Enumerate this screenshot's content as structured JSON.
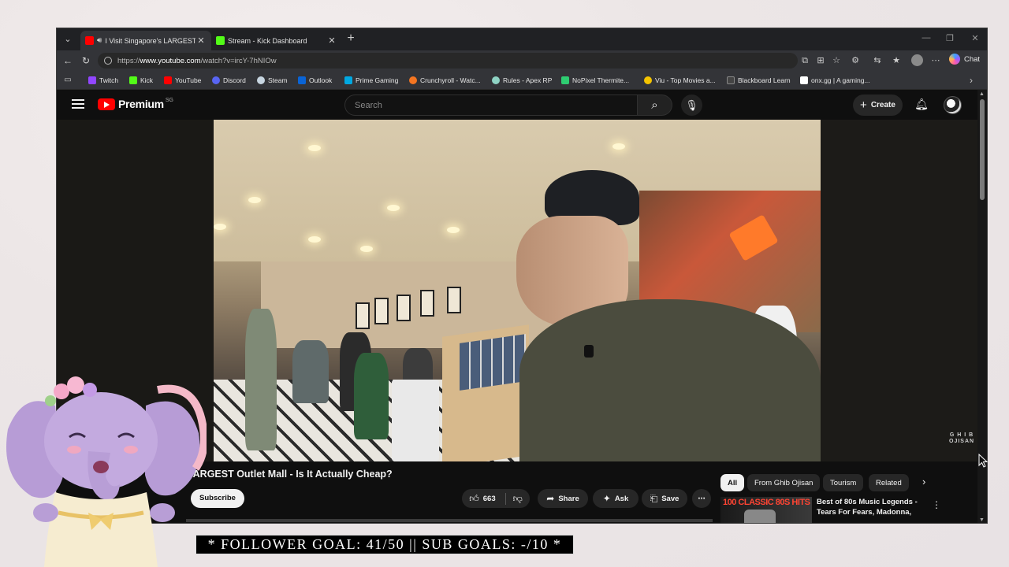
{
  "browser": {
    "tabs": [
      {
        "title": "I Visit Singapore's LARGEST O",
        "active": true,
        "audio": true,
        "favicon_color": "#ff0000"
      },
      {
        "title": "Stream - Kick Dashboard",
        "active": false,
        "audio": false,
        "favicon_color": "#53fc18"
      }
    ],
    "url_prefix": "https://",
    "url_host": "www.youtube.com",
    "url_path": "/watch?v=ircY-7hNIOw",
    "copilot_label": "Chat",
    "bookmarks": [
      {
        "label": "Twitch",
        "color": "#9146ff"
      },
      {
        "label": "Kick",
        "color": "#53fc18"
      },
      {
        "label": "YouTube",
        "color": "#ff0000"
      },
      {
        "label": "Discord",
        "color": "#5865f2"
      },
      {
        "label": "Steam",
        "color": "#c7d5e0"
      },
      {
        "label": "Outlook",
        "color": "#0a64d6"
      },
      {
        "label": "Prime Gaming",
        "color": "#00a8e1"
      },
      {
        "label": "Crunchyroll - Watc...",
        "color": "#f47521"
      },
      {
        "label": "Rules - Apex RP",
        "color": "#8fd3c4"
      },
      {
        "label": "NoPixel Thermite...",
        "color": "#2ecc71"
      },
      {
        "label": "Viu - Top Movies a...",
        "color": "#f5c400"
      },
      {
        "label": "Blackboard Learn",
        "color": "#262626"
      },
      {
        "label": "onx.gg | A gaming...",
        "color": "#ffffff"
      }
    ]
  },
  "youtube": {
    "logo_word": "Premium",
    "region": "SG",
    "search_placeholder": "Search",
    "create_label": "Create",
    "video_title": "LARGEST Outlet Mall - Is It Actually Cheap?",
    "watermark_line1": "G H I B",
    "watermark_line2": "OJISAN",
    "subscribe_label": "Subscribe",
    "like_count": "663",
    "share_label": "Share",
    "ask_label": "Ask",
    "save_label": "Save",
    "chips": [
      "All",
      "From Ghib Ojisan",
      "Tourism",
      "Related"
    ],
    "recommendation": {
      "thumb_text": "100 CLASSIC 80S HITS",
      "title": "Best of 80s Music Legends - Tears For Fears, Madonna, ..."
    }
  },
  "overlay": {
    "goal_banner": "* FOLLOWER GOAL: 41/50 || SUB GOALS: -/10 *"
  }
}
